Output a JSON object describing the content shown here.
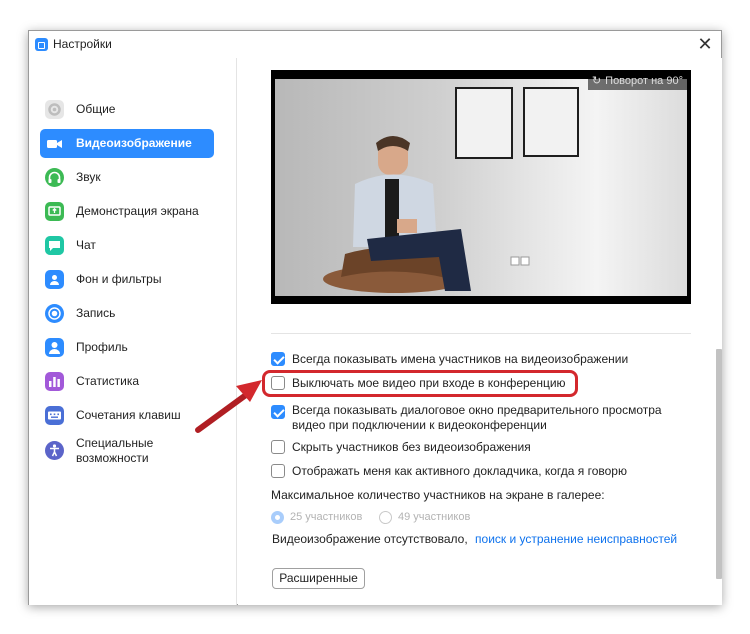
{
  "window": {
    "title": "Настройки"
  },
  "sidebar": {
    "items": [
      {
        "label": "Общие",
        "icon": "gear-icon",
        "color": "#e3e3e3",
        "active": false
      },
      {
        "label": "Видеоизображение",
        "icon": "video-camera-icon",
        "color": "#2d8cff",
        "active": true
      },
      {
        "label": "Звук",
        "icon": "headphones-icon",
        "color": "#3cba54",
        "active": false
      },
      {
        "label": "Демонстрация экрана",
        "icon": "share-screen-icon",
        "color": "#3cba54",
        "active": false
      },
      {
        "label": "Чат",
        "icon": "chat-icon",
        "color": "#1fc7a4",
        "active": false
      },
      {
        "label": "Фон и фильтры",
        "icon": "background-icon",
        "color": "#2d8cff",
        "active": false
      },
      {
        "label": "Запись",
        "icon": "record-icon",
        "color": "#2d8cff",
        "active": false
      },
      {
        "label": "Профиль",
        "icon": "profile-icon",
        "color": "#2d8cff",
        "active": false
      },
      {
        "label": "Статистика",
        "icon": "statistics-icon",
        "color": "#a259d9",
        "active": false
      },
      {
        "label": "Сочетания клавиш",
        "icon": "keyboard-icon",
        "color": "#4a6fd6",
        "active": false
      },
      {
        "label_line1": "Специальные",
        "label_line2": "возможности",
        "icon": "accessibility-icon",
        "color": "#5b64c9",
        "active": false
      }
    ]
  },
  "preview": {
    "rotate_label": "Поворот на 90°"
  },
  "options": {
    "show_names": {
      "label": "Всегда показывать имена участников на видеоизображении",
      "checked": true
    },
    "turn_off_video": {
      "label": "Выключать мое видео при входе в конференцию",
      "checked": false
    },
    "preview_dialog": {
      "line1": "Всегда показывать диалоговое окно предварительного просмотра",
      "line2": "видео при подключении к видеоконференции",
      "checked": true
    },
    "hide_no_video": {
      "label": "Скрыть участников без видеоизображения",
      "checked": false
    },
    "spotlight_self": {
      "label": "Отображать меня как активного докладчика, когда я говорю",
      "checked": false
    }
  },
  "gallery": {
    "title": "Максимальное количество участников на экране в галерее:",
    "option_25": "25 участников",
    "option_49": "49 участников",
    "selected": "25 участников"
  },
  "troubleshoot": {
    "text": "Видеоизображение отсутствовало,",
    "link": "поиск и устранение неисправностей"
  },
  "advanced_button": "Расширенные",
  "colors": {
    "accent": "#2d8cff",
    "highlight": "#d3282d",
    "link": "#0e72ed"
  }
}
